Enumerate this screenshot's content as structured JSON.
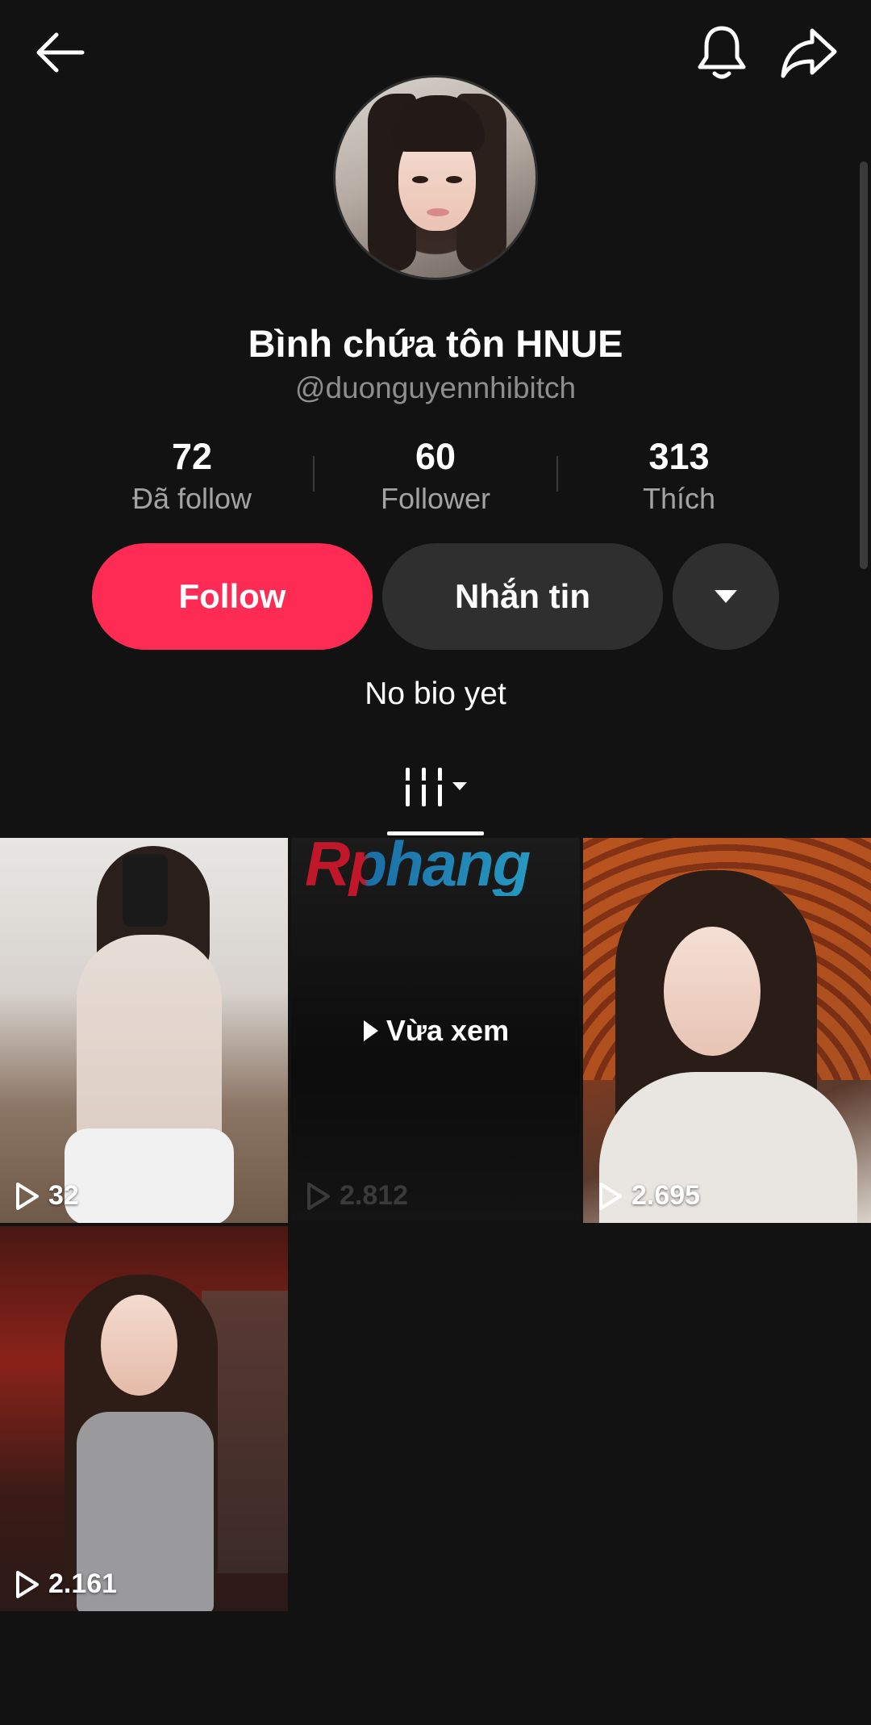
{
  "header": {
    "back_icon": "arrow-left-icon",
    "bell_icon": "bell-icon",
    "share_icon": "share-arrow-icon"
  },
  "profile": {
    "display_name": "Bình chứa tôn HNUE",
    "username": "@duonguyennhibitch",
    "bio": "No bio yet"
  },
  "stats": [
    {
      "value": "72",
      "label": "Đã follow"
    },
    {
      "value": "60",
      "label": "Follower"
    },
    {
      "value": "313",
      "label": "Thích"
    }
  ],
  "actions": {
    "follow_label": "Follow",
    "message_label": "Nhắn tin",
    "more_icon": "caret-down-icon"
  },
  "colors": {
    "accent": "#fe2c55",
    "background": "#121212",
    "secondary_button": "#2f2f2f"
  },
  "tabs": {
    "grid_icon": "grid-columns-icon"
  },
  "watermark_text": "Rphang",
  "videos": [
    {
      "views": "32"
    },
    {
      "views": "2.812",
      "overlay": "Vừa xem"
    },
    {
      "views": "2.695"
    },
    {
      "views": "2.161"
    }
  ]
}
